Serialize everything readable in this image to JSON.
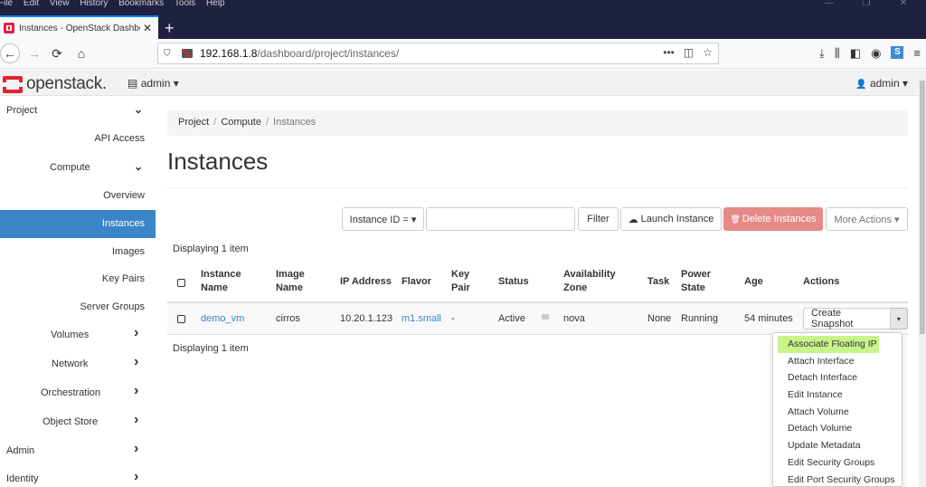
{
  "browser": {
    "menu": [
      "File",
      "Edit",
      "View",
      "History",
      "Bookmarks",
      "Tools",
      "Help"
    ],
    "tab_title": "Instances - OpenStack Dashboard",
    "url_host": "192.168.1.8",
    "url_path": "/dashboard/project/instances/",
    "icons": {
      "back": "←",
      "forward": "→",
      "reload": "⟳",
      "home": "⌂",
      "close": "✕",
      "new_tab": "+",
      "shield": "⛉",
      "more": "•••",
      "pocket": "◫",
      "star": "☆",
      "download": "⤓",
      "library": "⫼",
      "sidebar": "◧",
      "account": "◉",
      "sync": "S",
      "menu": "≡",
      "minimize": "—",
      "restore": "❐",
      "win_close": "✕"
    }
  },
  "header": {
    "logo_text": "openstack.",
    "project": "admin",
    "user": "admin",
    "caret": "▾",
    "project_icon": "▤",
    "user_icon": "👤"
  },
  "sidebar": {
    "items": [
      {
        "label": "Project",
        "chevron": "⌄"
      },
      {
        "label": "API Access"
      },
      {
        "label": "Compute",
        "chevron": "⌄"
      },
      {
        "label": "Overview"
      },
      {
        "label": "Instances",
        "active": true
      },
      {
        "label": "Images"
      },
      {
        "label": "Key Pairs"
      },
      {
        "label": "Server Groups"
      },
      {
        "label": "Volumes",
        "chevron": "›"
      },
      {
        "label": "Network",
        "chevron": "›"
      },
      {
        "label": "Orchestration",
        "chevron": "›"
      },
      {
        "label": "Object Store",
        "chevron": "›"
      },
      {
        "label": "Admin",
        "chevron": "›"
      },
      {
        "label": "Identity",
        "chevron": "›"
      }
    ]
  },
  "breadcrumb": [
    "Project",
    "Compute",
    "Instances"
  ],
  "breadcrumb_sep": "/",
  "page_title": "Instances",
  "actions": {
    "filter_field": "Instance ID = ▾",
    "filter_value": "",
    "filter_label": "Filter",
    "launch_label": "Launch Instance",
    "launch_icon": "☁",
    "delete_label": "Delete Instances",
    "delete_icon": "🗑",
    "more_label": "More Actions ▾"
  },
  "table": {
    "count_text": "Displaying 1 item",
    "headers": [
      [
        "Instance",
        "Name"
      ],
      [
        "Image",
        "Name"
      ],
      [
        "IP Address"
      ],
      [
        "Flavor"
      ],
      [
        "Key",
        "Pair"
      ],
      [
        "Status"
      ],
      [
        "Availability",
        "Zone"
      ],
      [
        "Task"
      ],
      [
        "Power",
        "State"
      ],
      [
        "Age"
      ],
      [
        "Actions"
      ]
    ],
    "rows": [
      {
        "name": "demo_vm",
        "image": "cirros",
        "ip": "10.20.1.123",
        "flavor": "m1.small",
        "key_pair": "-",
        "status": "Active",
        "zone": "nova",
        "task": "None",
        "power": "Running",
        "age": "54 minutes",
        "action": "Create Snapshot",
        "caret": "▾"
      }
    ]
  },
  "row_menu": {
    "items": [
      "Associate Floating IP",
      "Attach Interface",
      "Detach Interface",
      "Edit Instance",
      "Attach Volume",
      "Detach Volume",
      "Update Metadata",
      "Edit Security Groups",
      "Edit Port Security Groups"
    ],
    "highlight_color": "#c8f48a"
  },
  "colors": {
    "accent": "#3c84c8",
    "danger": "#e58a87",
    "brand": "#e22435"
  }
}
